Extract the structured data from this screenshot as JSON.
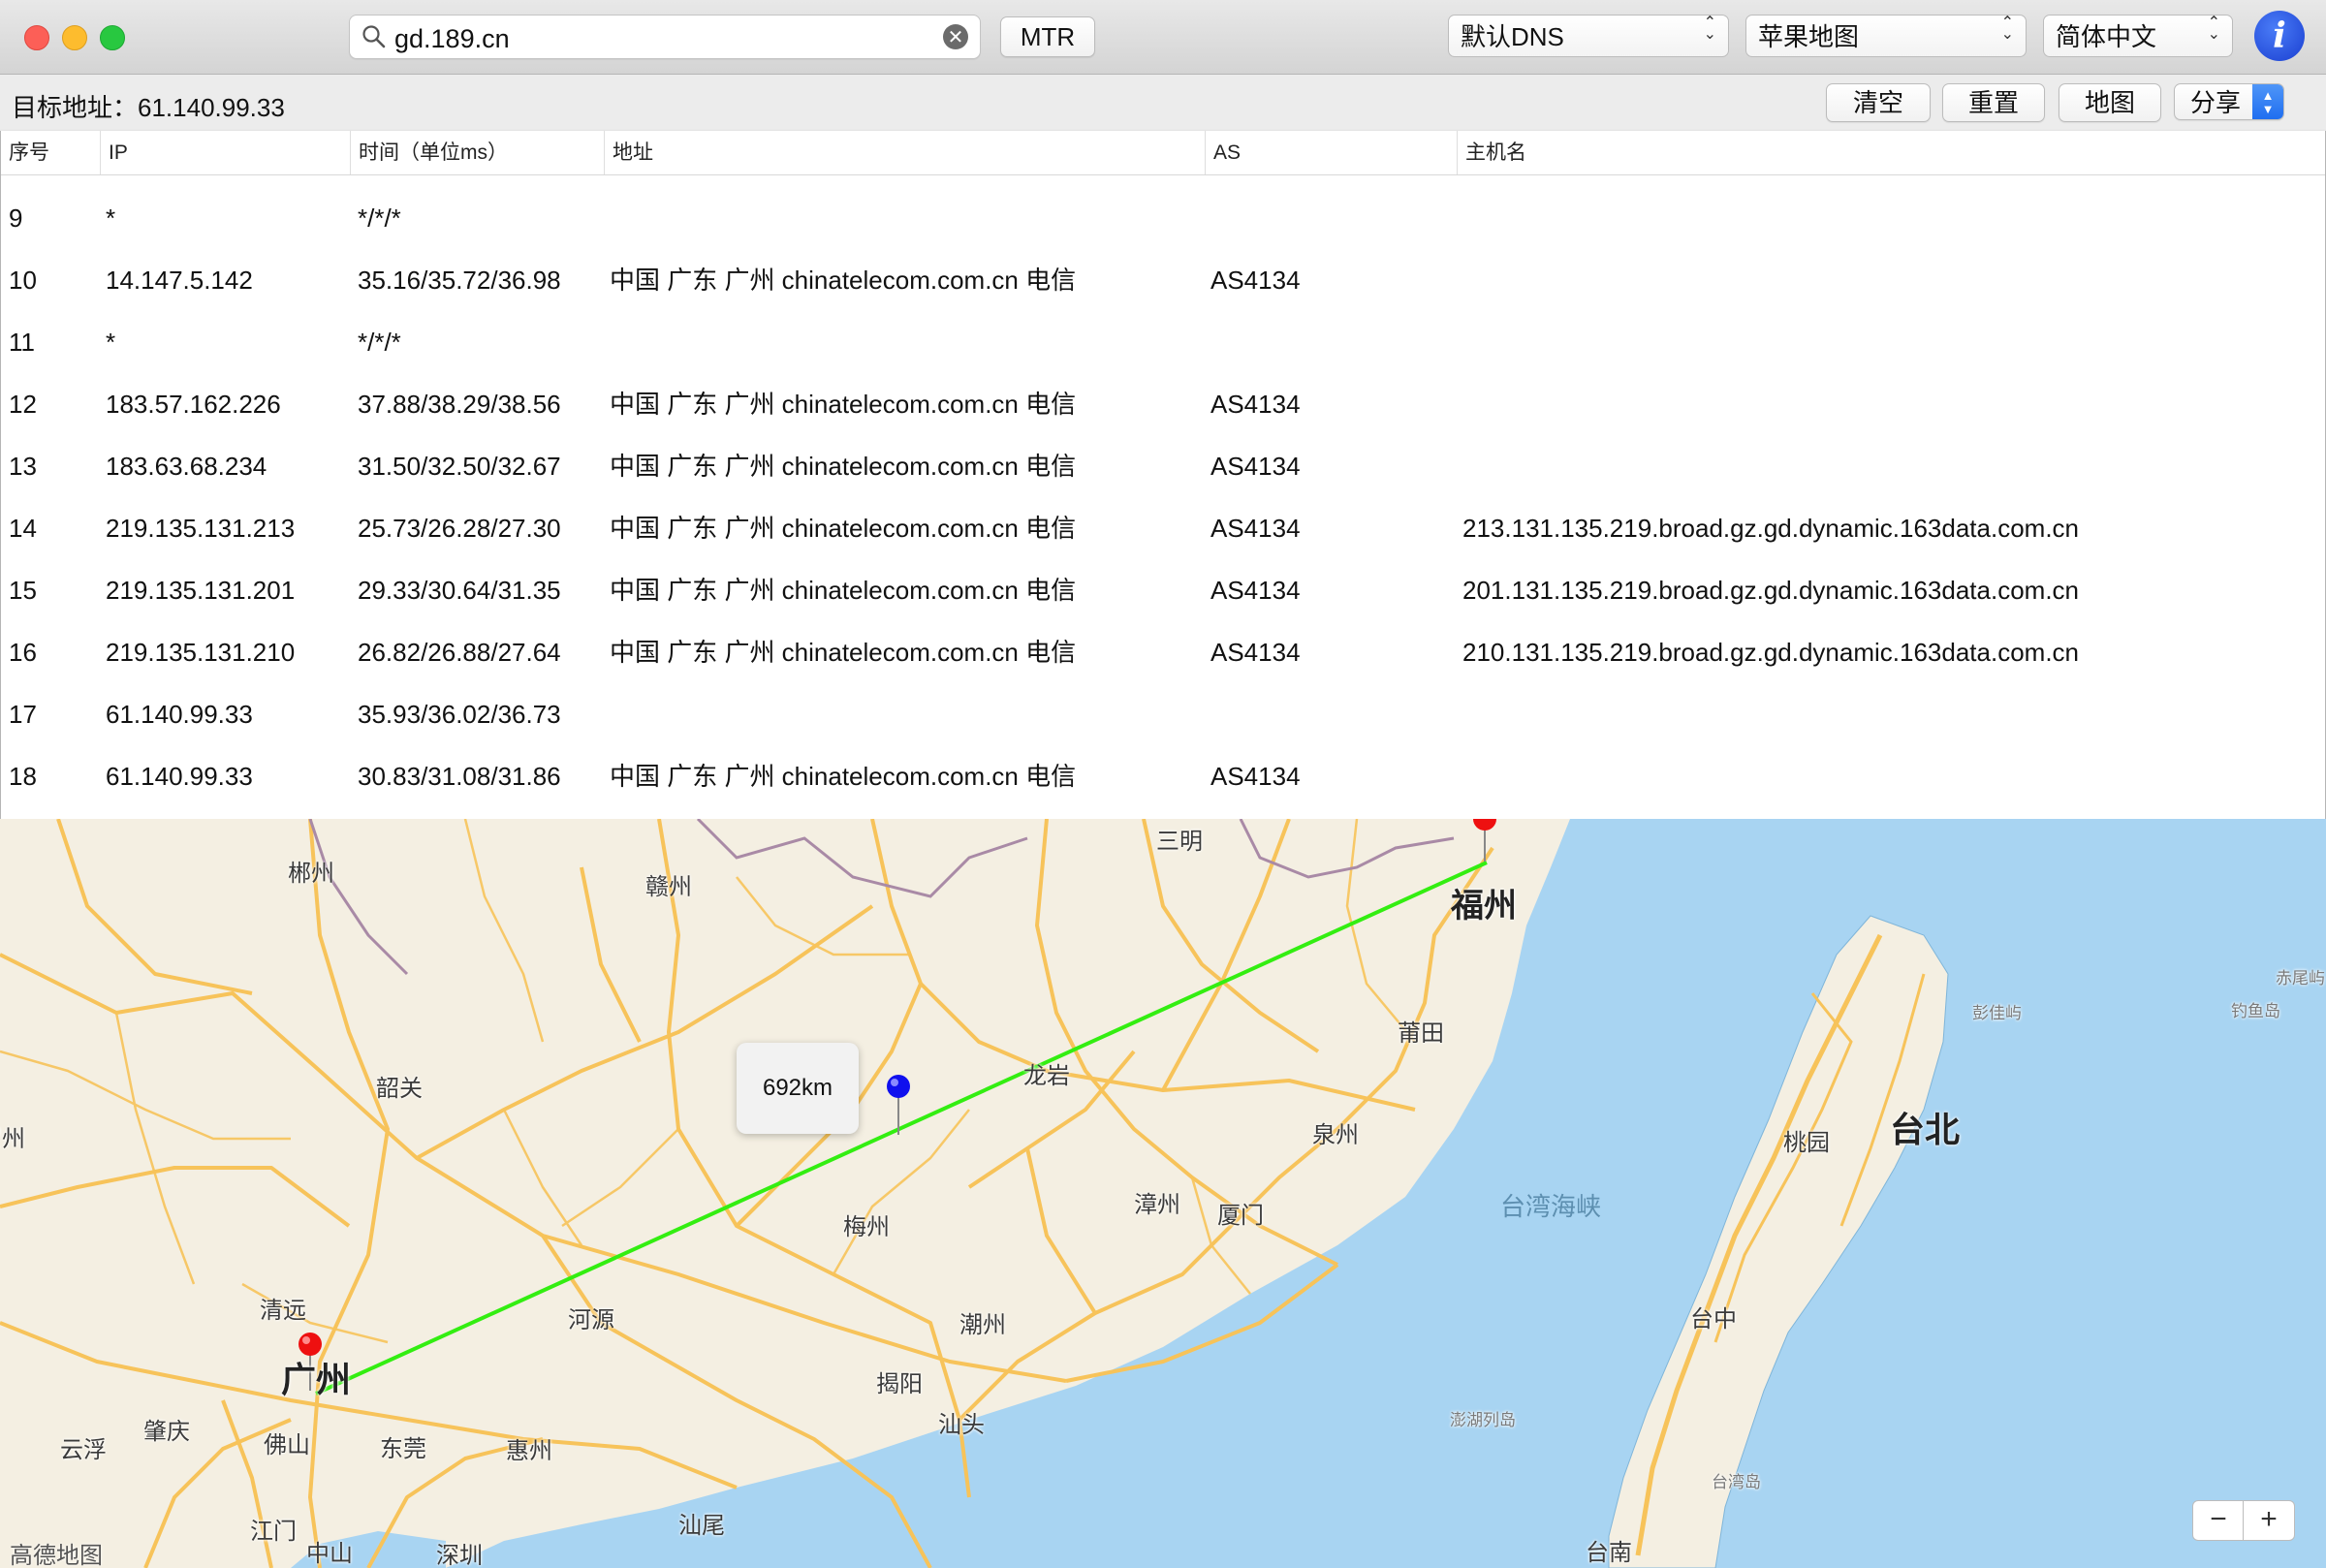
{
  "window": {
    "title": ""
  },
  "toolbar": {
    "search_value": "gd.189.cn",
    "mtr_label": "MTR",
    "dns_select": "默认DNS",
    "map_select": "苹果地图",
    "lang_select": "简体中文"
  },
  "subbar": {
    "target_label": "目标地址：",
    "target_value": "61.140.99.33",
    "clear_label": "清空",
    "reset_label": "重置",
    "map_label": "地图",
    "share_label": "分享"
  },
  "table": {
    "headers": {
      "seq": "序号",
      "ip": "IP",
      "time": "时间（单位ms）",
      "addr": "地址",
      "as": "AS",
      "host": "主机名"
    },
    "rows": [
      {
        "seq": "9",
        "ip": "*",
        "time": "*/*/*",
        "addr": "",
        "as": "",
        "host": ""
      },
      {
        "seq": "10",
        "ip": "14.147.5.142",
        "time": "35.16/35.72/36.98",
        "addr": "中国 广东 广州 chinatelecom.com.cn 电信",
        "as": "AS4134",
        "host": ""
      },
      {
        "seq": "11",
        "ip": "*",
        "time": "*/*/*",
        "addr": "",
        "as": "",
        "host": ""
      },
      {
        "seq": "12",
        "ip": "183.57.162.226",
        "time": "37.88/38.29/38.56",
        "addr": "中国 广东 广州 chinatelecom.com.cn 电信",
        "as": "AS4134",
        "host": ""
      },
      {
        "seq": "13",
        "ip": "183.63.68.234",
        "time": "31.50/32.50/32.67",
        "addr": "中国 广东 广州 chinatelecom.com.cn 电信",
        "as": "AS4134",
        "host": ""
      },
      {
        "seq": "14",
        "ip": "219.135.131.213",
        "time": "25.73/26.28/27.30",
        "addr": "中国 广东 广州 chinatelecom.com.cn 电信",
        "as": "AS4134",
        "host": "213.131.135.219.broad.gz.gd.dynamic.163data.com.cn"
      },
      {
        "seq": "15",
        "ip": "219.135.131.201",
        "time": "29.33/30.64/31.35",
        "addr": "中国 广东 广州 chinatelecom.com.cn 电信",
        "as": "AS4134",
        "host": "201.131.135.219.broad.gz.gd.dynamic.163data.com.cn"
      },
      {
        "seq": "16",
        "ip": "219.135.131.210",
        "time": "26.82/26.88/27.64",
        "addr": "中国 广东 广州 chinatelecom.com.cn 电信",
        "as": "AS4134",
        "host": "210.131.135.219.broad.gz.gd.dynamic.163data.com.cn"
      },
      {
        "seq": "17",
        "ip": "61.140.99.33",
        "time": "35.93/36.02/36.73",
        "addr": "",
        "as": "",
        "host": ""
      },
      {
        "seq": "18",
        "ip": "61.140.99.33",
        "time": "30.83/31.08/31.86",
        "addr": "中国 广东 广州 chinatelecom.com.cn 电信",
        "as": "AS4134",
        "host": ""
      }
    ]
  },
  "map": {
    "distance_label": "692km",
    "cities": {
      "chenzhou": "郴州",
      "ganzhou": "赣州",
      "sanming": "三明",
      "fuzhou": "福州",
      "shaoguan": "韶关",
      "hezhou": "贺州",
      "putian": "莆田",
      "longyan": "龙岩",
      "quanzhou": "泉州",
      "taipei": "台北",
      "taoyuan": "桃园",
      "zhangzhou": "漳州",
      "xiamen": "厦门",
      "meizhou": "梅州",
      "strait": "台湾海峡",
      "qingyuan": "清远",
      "heyuan": "河源",
      "chaozhou": "潮州",
      "guangzhou": "广州",
      "jieyang": "揭阳",
      "zhaoqing": "肇庆",
      "yunfu": "云浮",
      "foshan": "佛山",
      "dongguan": "东莞",
      "huizhou": "惠州",
      "shantou": "汕头",
      "taizhong": "台中",
      "shanwei": "汕尾",
      "jiangmen": "江门",
      "zhongshan": "中山",
      "shenzhen": "深圳",
      "tainan": "台南",
      "penghu": "澎湖列岛",
      "pengjia": "彭佳屿",
      "diaoyu": "钓鱼岛",
      "chiwei": "赤尾屿",
      "taiwanisland": "台湾岛"
    },
    "credit": "高德地图",
    "zoom_out": "−",
    "zoom_in": "+",
    "colors": {
      "route": "#33ee11",
      "land": "#f4efe2",
      "sea": "#a8d4f2",
      "road": "#f7c35a"
    }
  }
}
